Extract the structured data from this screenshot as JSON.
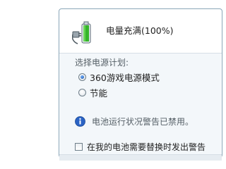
{
  "battery": {
    "status_text": "电量充满(100%)",
    "charge_percent": 100,
    "icon": "battery-charging-plug-icon"
  },
  "power_plan": {
    "heading": "选择电源计划:",
    "options": [
      {
        "label": "360游戏电源模式",
        "selected": true
      },
      {
        "label": "节能",
        "selected": false
      }
    ]
  },
  "info": {
    "icon": "info-icon",
    "text": "电池运行状况警告已禁用。"
  },
  "warning_option": {
    "label": "在我的电池需要替换时发出警告",
    "checked": false
  },
  "colors": {
    "battery_fill": "#35b52a",
    "info_icon": "#2a63c4",
    "border": "#8aa6b8"
  }
}
